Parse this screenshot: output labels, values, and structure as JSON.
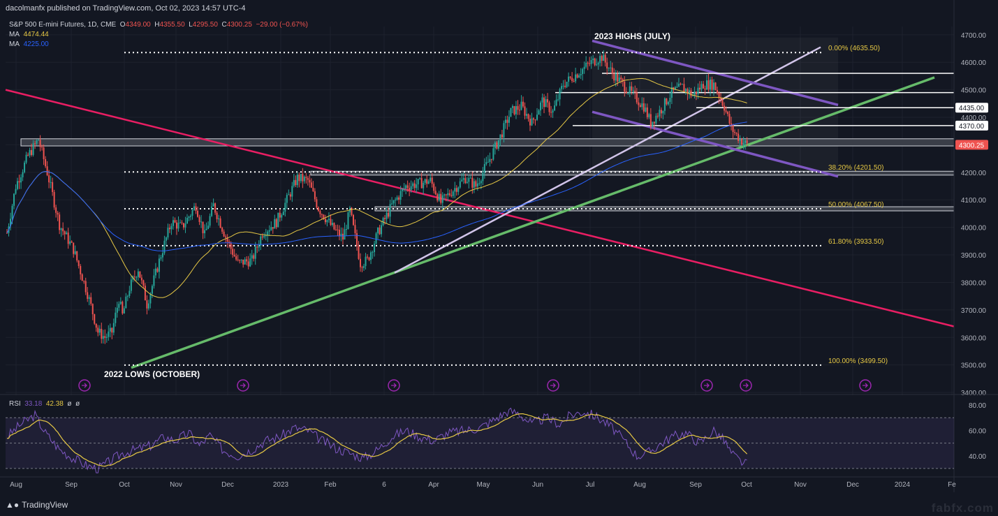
{
  "header": {
    "publisher": "dacolmanfx published on TradingView.com, Oct 02, 2023 14:57 UTC-4",
    "symbol": "S&P 500 E-mini Futures, 1D, CME",
    "o_label": "O",
    "o": "4349.00",
    "h_label": "H",
    "h": "4355.50",
    "l_label": "L",
    "l": "4295.50",
    "c_label": "C",
    "c": "4300.25",
    "change": "−29.00 (−0.67%)",
    "ma1_label": "MA",
    "ma1": "4474.44",
    "ma1_color": "#e6c845",
    "ma2_label": "MA",
    "ma2": "4225.00",
    "ma2_color": "#2962ff"
  },
  "rsi_header": {
    "label": "RSI",
    "v1": "33.18",
    "v2": "42.38",
    "v3": "ø",
    "v4": "ø"
  },
  "footer": {
    "brand": "TradingView",
    "watermark": "fabfx.com"
  },
  "colors": {
    "bg": "#131722",
    "up": "#26a69a",
    "down": "#ef5350",
    "trend_red": "#e91e63",
    "trend_green": "#66bb6a",
    "channel": "#7e57c2",
    "lavender": "#d1c4e9",
    "rsi_line": "#7e57c2",
    "rsi_ma": "#e6c845",
    "grid": "#1e222d"
  },
  "chart_data": {
    "type": "candlestick",
    "price_axis": {
      "ticks": [
        "4700.00",
        "4600.00",
        "4500.00",
        "4400.00",
        "4300.00",
        "4200.00",
        "4100.00",
        "4000.00",
        "3900.00",
        "3800.00",
        "3700.00",
        "3600.00",
        "3500.00",
        "3400.00"
      ],
      "ylim": [
        3390,
        4730
      ]
    },
    "time_axis": {
      "labels": [
        "Aug",
        "Sep",
        "Oct",
        "Nov",
        "Dec",
        "2023",
        "Feb",
        "6",
        "Apr",
        "May",
        "Jun",
        "Jul",
        "Aug",
        "Sep",
        "Oct",
        "Nov",
        "Dec",
        "2024",
        "Fe"
      ]
    },
    "annotations": {
      "highs_label": "2023 HIGHS (JULY)",
      "lows_label": "2022 LOWS (OCTOBER)"
    },
    "fib_levels": [
      {
        "label": "0.00% (4635.50)",
        "value": 4635.5
      },
      {
        "label": "38.20% (4201.50)",
        "value": 4201.5
      },
      {
        "label": "50.00% (4067.50)",
        "value": 4067.5
      },
      {
        "label": "61.80% (3933.50)",
        "value": 3933.5
      },
      {
        "label": "100.00% (3499.50)",
        "value": 3499.5
      }
    ],
    "price_badges": [
      {
        "label": "4435.00",
        "value": 4435
      },
      {
        "label": "4370.00",
        "value": 4370
      },
      {
        "label": "4300.25",
        "value": 4300.25,
        "color": "#ef5350"
      }
    ],
    "key_points": [
      [
        0,
        3980
      ],
      [
        5,
        4150
      ],
      [
        12,
        4260
      ],
      [
        18,
        4320
      ],
      [
        23,
        4200
      ],
      [
        30,
        4010
      ],
      [
        38,
        3920
      ],
      [
        46,
        3760
      ],
      [
        52,
        3620
      ],
      [
        56,
        3600
      ],
      [
        60,
        3620
      ],
      [
        64,
        3740
      ],
      [
        66,
        3680
      ],
      [
        70,
        3780
      ],
      [
        75,
        3850
      ],
      [
        80,
        3720
      ],
      [
        88,
        3900
      ],
      [
        94,
        4020
      ],
      [
        100,
        4000
      ],
      [
        108,
        4080
      ],
      [
        113,
        3970
      ],
      [
        118,
        4080
      ],
      [
        126,
        3950
      ],
      [
        132,
        3870
      ],
      [
        140,
        3880
      ],
      [
        146,
        3980
      ],
      [
        154,
        4020
      ],
      [
        160,
        4100
      ],
      [
        166,
        4180
      ],
      [
        172,
        4170
      ],
      [
        178,
        4070
      ],
      [
        186,
        4000
      ],
      [
        192,
        3960
      ],
      [
        196,
        4060
      ],
      [
        202,
        3870
      ],
      [
        206,
        3880
      ],
      [
        212,
        3980
      ],
      [
        220,
        4080
      ],
      [
        228,
        4150
      ],
      [
        236,
        4160
      ],
      [
        242,
        4170
      ],
      [
        248,
        4090
      ],
      [
        254,
        4130
      ],
      [
        262,
        4180
      ],
      [
        268,
        4150
      ],
      [
        276,
        4250
      ],
      [
        282,
        4330
      ],
      [
        288,
        4420
      ],
      [
        294,
        4440
      ],
      [
        300,
        4380
      ],
      [
        306,
        4460
      ],
      [
        312,
        4420
      ],
      [
        318,
        4520
      ],
      [
        326,
        4560
      ],
      [
        334,
        4600
      ],
      [
        340,
        4620
      ],
      [
        346,
        4560
      ],
      [
        352,
        4520
      ],
      [
        358,
        4480
      ],
      [
        364,
        4440
      ],
      [
        368,
        4380
      ],
      [
        374,
        4430
      ],
      [
        380,
        4490
      ],
      [
        386,
        4510
      ],
      [
        392,
        4480
      ],
      [
        398,
        4520
      ],
      [
        404,
        4520
      ],
      [
        410,
        4440
      ],
      [
        414,
        4360
      ],
      [
        419,
        4320
      ],
      [
        423,
        4300
      ]
    ],
    "rsi": {
      "ticks": [
        "80.00",
        "60.00",
        "40.00"
      ],
      "ylim": [
        25,
        85
      ],
      "key_points": [
        [
          0,
          55
        ],
        [
          8,
          65
        ],
        [
          16,
          72
        ],
        [
          22,
          58
        ],
        [
          30,
          45
        ],
        [
          38,
          38
        ],
        [
          46,
          32
        ],
        [
          52,
          30
        ],
        [
          58,
          35
        ],
        [
          66,
          42
        ],
        [
          74,
          45
        ],
        [
          82,
          48
        ],
        [
          90,
          55
        ],
        [
          96,
          52
        ],
        [
          104,
          58
        ],
        [
          110,
          48
        ],
        [
          116,
          56
        ],
        [
          124,
          44
        ],
        [
          132,
          40
        ],
        [
          140,
          45
        ],
        [
          148,
          52
        ],
        [
          156,
          55
        ],
        [
          164,
          62
        ],
        [
          172,
          60
        ],
        [
          180,
          52
        ],
        [
          188,
          46
        ],
        [
          196,
          42
        ],
        [
          204,
          38
        ],
        [
          212,
          45
        ],
        [
          220,
          55
        ],
        [
          228,
          60
        ],
        [
          236,
          55
        ],
        [
          244,
          52
        ],
        [
          252,
          58
        ],
        [
          262,
          60
        ],
        [
          270,
          62
        ],
        [
          278,
          68
        ],
        [
          286,
          75
        ],
        [
          292,
          74
        ],
        [
          300,
          65
        ],
        [
          308,
          70
        ],
        [
          316,
          65
        ],
        [
          322,
          72
        ],
        [
          330,
          75
        ],
        [
          338,
          70
        ],
        [
          346,
          62
        ],
        [
          354,
          50
        ],
        [
          360,
          40
        ],
        [
          366,
          42
        ],
        [
          372,
          48
        ],
        [
          380,
          55
        ],
        [
          388,
          58
        ],
        [
          396,
          50
        ],
        [
          404,
          60
        ],
        [
          410,
          52
        ],
        [
          414,
          42
        ],
        [
          419,
          36
        ],
        [
          423,
          33
        ]
      ]
    }
  }
}
